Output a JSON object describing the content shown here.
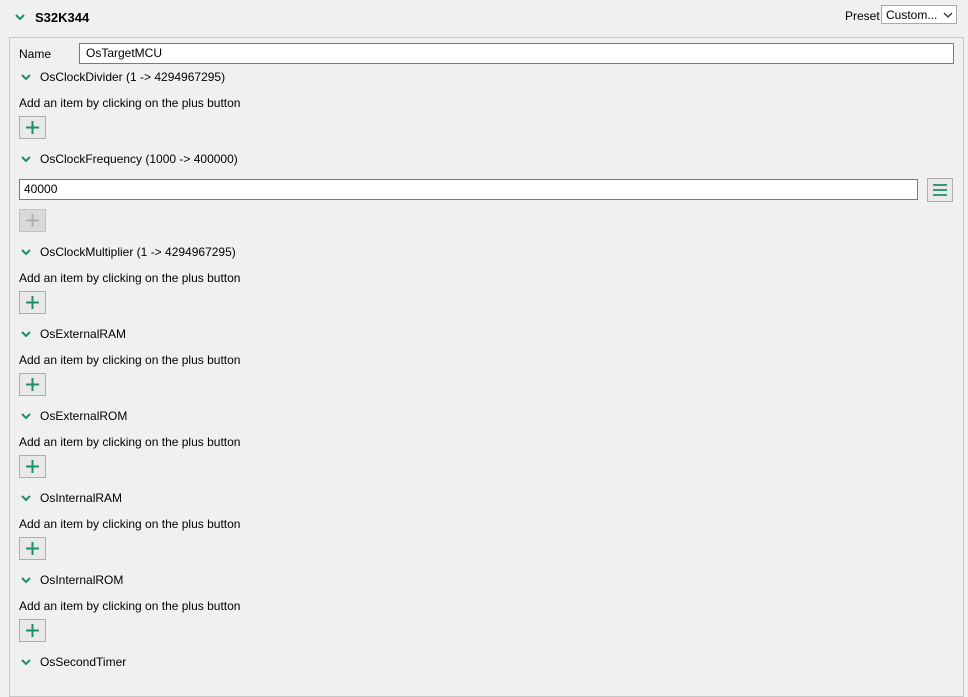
{
  "header": {
    "title": "S32K344",
    "preset_label": "Preset",
    "preset_value": "Custom..."
  },
  "name": {
    "label": "Name",
    "value": "OsTargetMCU"
  },
  "hint_text": "Add an item by clicking on the plus button",
  "sections": {
    "clock_divider": {
      "title": "OsClockDivider (1 -> 4294967295)"
    },
    "clock_frequency": {
      "title": "OsClockFrequency (1000 -> 400000)",
      "value": "40000"
    },
    "clock_multiplier": {
      "title": "OsClockMultiplier (1 -> 4294967295)"
    },
    "external_ram": {
      "title": "OsExternalRAM"
    },
    "external_rom": {
      "title": "OsExternalROM"
    },
    "internal_ram": {
      "title": "OsInternalRAM"
    },
    "internal_rom": {
      "title": "OsInternalROM"
    },
    "second_timer": {
      "title": "OsSecondTimer"
    }
  },
  "icons": {
    "chevron": "chevron-down-icon",
    "plus": "plus-icon",
    "menu": "hamburger-menu-icon"
  },
  "colors": {
    "accent": "#1e8c6e",
    "disabled": "#b0b0b0"
  }
}
